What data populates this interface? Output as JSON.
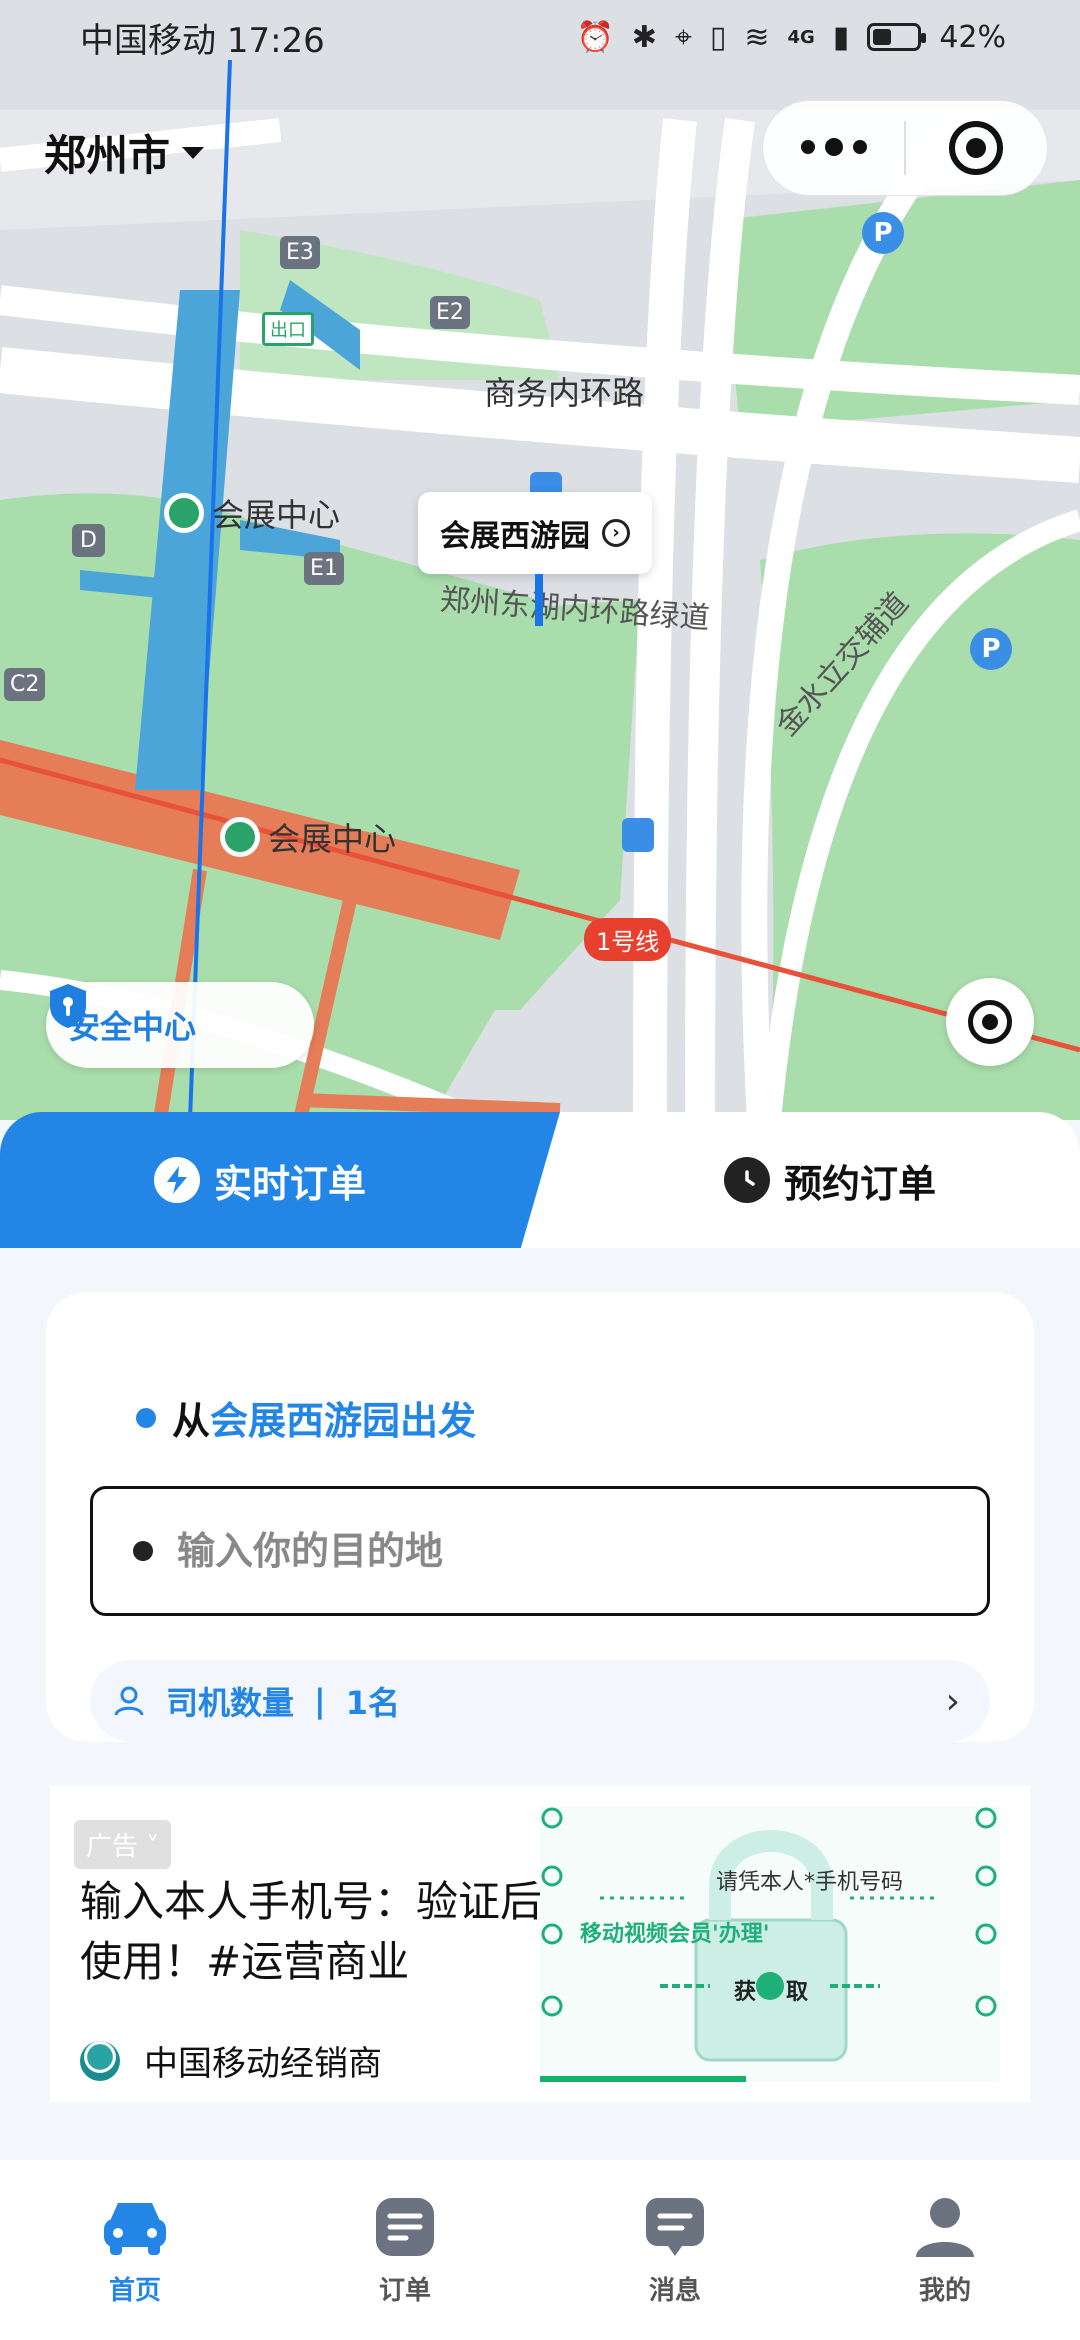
{
  "status_bar": {
    "carrier": "中国移动",
    "time": "17:26",
    "network": "4G",
    "battery": "42%",
    "battery_level": 0.42
  },
  "map": {
    "city": "郑州市",
    "labels": {
      "road_inner_ring": "商务内环路",
      "greenway": "郑州东湖内环路绿道",
      "interchange": "金水立交辅道",
      "station_north": "会展中心",
      "station_south": "会展中心",
      "line_badge": "1号线",
      "exit": "出口",
      "gate_e3": "E3",
      "gate_e2": "E2",
      "gate_e1": "E1",
      "gate_d": "D",
      "gate_c2": "C2",
      "parking": "P"
    },
    "place_popup": "会展西游园",
    "safety_center": "安全中心"
  },
  "tabs": {
    "realtime": "实时订单",
    "scheduled": "预约订单"
  },
  "order_card": {
    "from_prefix": "从",
    "from_location": "会展西游园",
    "from_suffix": "出发",
    "destination_placeholder": "输入你的目的地",
    "destination_value": "",
    "drivers_label": "司机数量",
    "drivers_separator": "|",
    "drivers_count": "1名"
  },
  "ad": {
    "tag": "广告",
    "title": "输入本人手机号：验证后使用！#运营商业",
    "brand": "中国移动经销商",
    "image_text_1": "请凭本人*手机号码",
    "image_text_2": "移动视频会员'办理'",
    "image_text_3": "获取"
  },
  "nav": {
    "items": [
      {
        "label": "首页",
        "icon": "car-icon"
      },
      {
        "label": "订单",
        "icon": "order-list-icon"
      },
      {
        "label": "消息",
        "icon": "message-icon"
      },
      {
        "label": "我的",
        "icon": "profile-icon"
      }
    ]
  },
  "colors": {
    "accent": "#2386e6",
    "metro_line": "#e8523a",
    "park": "#a6dcaa",
    "ad_green": "#14b36b"
  }
}
